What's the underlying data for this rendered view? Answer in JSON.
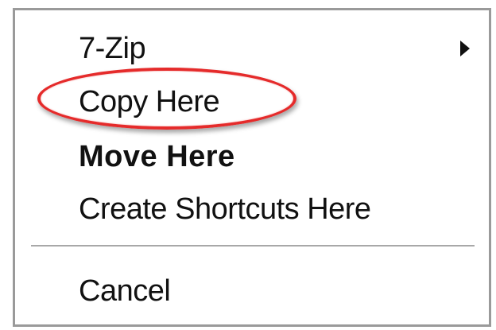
{
  "context_menu": {
    "items": [
      {
        "label": "7-Zip",
        "has_submenu": true,
        "bold": false
      },
      {
        "label": "Copy Here",
        "has_submenu": false,
        "bold": false,
        "highlighted": true
      },
      {
        "label": "Move Here",
        "has_submenu": false,
        "bold": true
      },
      {
        "label": "Create Shortcuts Here",
        "has_submenu": false,
        "bold": false
      },
      {
        "label": "Cancel",
        "has_submenu": false,
        "bold": false
      }
    ],
    "submenu_icon": "chevron-right-icon",
    "highlight_color": "#e52b2b"
  }
}
